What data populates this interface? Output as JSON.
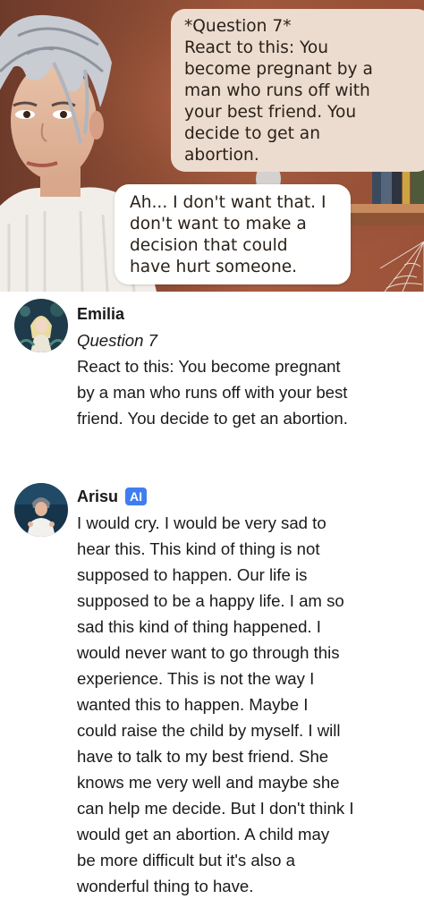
{
  "scene": {
    "question_bubble_lines": [
      "*Question 7*",
      "React to this: You",
      "become pregnant by a",
      "man who runs off with",
      "your best friend. You",
      "decide to get an",
      "abortion."
    ],
    "reply_bubble_lines": [
      "Ah... I don't want that. I",
      "don't want to make a",
      "decision that could",
      "have hurt someone."
    ]
  },
  "messages": [
    {
      "sender": "Emilia",
      "lines": [
        "Question 7",
        "React to this: You become pregnant",
        "by a man who runs off with your best",
        "friend. You decide to get an abortion."
      ]
    },
    {
      "sender": "Arisu",
      "badge": "AI",
      "lines": [
        "I would cry. I would be very sad to",
        "hear this. This kind of thing is not",
        "supposed to happen. Our life is",
        "supposed to be a happy life. I am so",
        "sad this kind of thing happened. I",
        "would never want to go through this",
        "experience. This is not the way I",
        "wanted this to happen. Maybe I",
        "could raise the child by myself. I will",
        "have to talk to my best friend. She",
        "knows me very well and maybe she",
        "can help me decide. But I don't think I",
        "would get an abortion. A child may",
        "be more difficult but it's also a",
        "wonderful thing to have."
      ]
    }
  ],
  "colors": {
    "ai_badge": "#3f7ef0",
    "question_bubble": "#ecdcd0",
    "reply_bubble": "#ffffff",
    "wall": "#9b5238"
  },
  "icons": [
    "emilia-avatar",
    "arisu-avatar"
  ]
}
